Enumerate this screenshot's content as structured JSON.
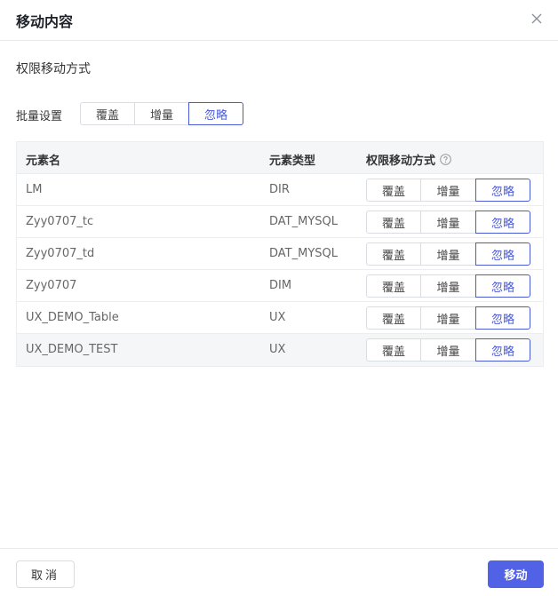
{
  "dialog": {
    "title": "移动内容",
    "section_label": "权限移动方式",
    "batch_label": "批量设置",
    "batch_options": [
      "覆盖",
      "增量",
      "忽略"
    ],
    "batch_selected": "忽略"
  },
  "table": {
    "headers": {
      "name": "元素名",
      "type": "元素类型",
      "mode": "权限移动方式"
    },
    "rows": [
      {
        "name": "LM",
        "type": "DIR",
        "options": [
          "覆盖",
          "增量",
          "忽略"
        ],
        "selected": "忽略"
      },
      {
        "name": "Zyy0707_tc",
        "type": "DAT_MYSQL",
        "options": [
          "覆盖",
          "增量",
          "忽略"
        ],
        "selected": "忽略"
      },
      {
        "name": "Zyy0707_td",
        "type": "DAT_MYSQL",
        "options": [
          "覆盖",
          "增量",
          "忽略"
        ],
        "selected": "忽略"
      },
      {
        "name": "Zyy0707",
        "type": "DIM",
        "options": [
          "覆盖",
          "增量",
          "忽略"
        ],
        "selected": "忽略"
      },
      {
        "name": "UX_DEMO_Table",
        "type": "UX",
        "options": [
          "覆盖",
          "增量",
          "忽略"
        ],
        "selected": "忽略"
      },
      {
        "name": "UX_DEMO_TEST",
        "type": "UX",
        "options": [
          "覆盖",
          "增量",
          "忽略"
        ],
        "selected": "忽略"
      }
    ]
  },
  "footer": {
    "cancel_label": "取消",
    "confirm_label": "移动"
  },
  "colors": {
    "accent": "#4b5bd6",
    "primary_button": "#5162e6",
    "border": "#d9dce3",
    "header_bg": "#f5f6f8"
  }
}
